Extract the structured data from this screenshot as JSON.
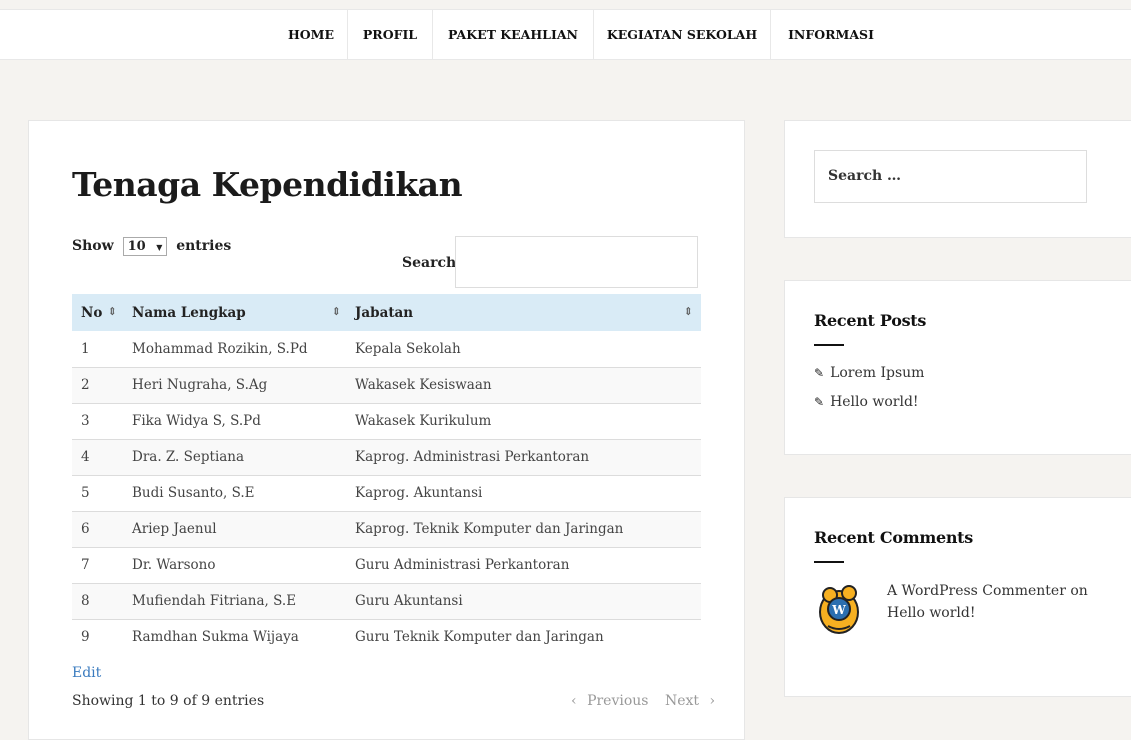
{
  "nav": {
    "items": [
      "HOME",
      "PROFIL",
      "PAKET KEAHLIAN",
      "KEGIATAN SEKOLAH",
      "INFORMASI"
    ]
  },
  "main": {
    "title": "Tenaga Kependidikan",
    "show_label": "Show",
    "length_value": "10",
    "entries_label": "entries",
    "search_label": "Search:",
    "search_value": "",
    "columns": [
      "No",
      "Nama Lengkap",
      "Jabatan"
    ],
    "rows": [
      [
        "1",
        "Mohammad Rozikin, S.Pd",
        "Kepala Sekolah"
      ],
      [
        "2",
        "Heri Nugraha, S.Ag",
        "Wakasek Kesiswaan"
      ],
      [
        "3",
        "Fika Widya S, S.Pd",
        "Wakasek Kurikulum"
      ],
      [
        "4",
        "Dra. Z. Septiana",
        "Kaprog. Administrasi Perkantoran"
      ],
      [
        "5",
        "Budi Susanto, S.E",
        "Kaprog. Akuntansi"
      ],
      [
        "6",
        "Ariep Jaenul",
        "Kaprog. Teknik Komputer dan Jaringan"
      ],
      [
        "7",
        "Dr. Warsono",
        "Guru Administrasi Perkantoran"
      ],
      [
        "8",
        "Mufiendah Fitriana, S.E",
        "Guru Akuntansi"
      ],
      [
        "9",
        "Ramdhan Sukma Wijaya",
        "Guru Teknik Komputer dan Jaringan"
      ]
    ],
    "edit_label": "Edit",
    "info_text": "Showing 1 to 9 of 9 entries",
    "prev_label": "Previous",
    "next_label": "Next"
  },
  "sidebar": {
    "search_placeholder": "Search …",
    "recent_posts_title": "Recent Posts",
    "posts": [
      "Lorem Ipsum",
      "Hello world!"
    ],
    "recent_comments_title": "Recent Comments",
    "comment": {
      "author": "A WordPress Commenter",
      "on": "on",
      "post": "Hello world!"
    }
  },
  "colors": {
    "page_bg": "#f5f3f0",
    "table_header_bg": "#d9ebf6",
    "link": "#3a7bbf"
  }
}
